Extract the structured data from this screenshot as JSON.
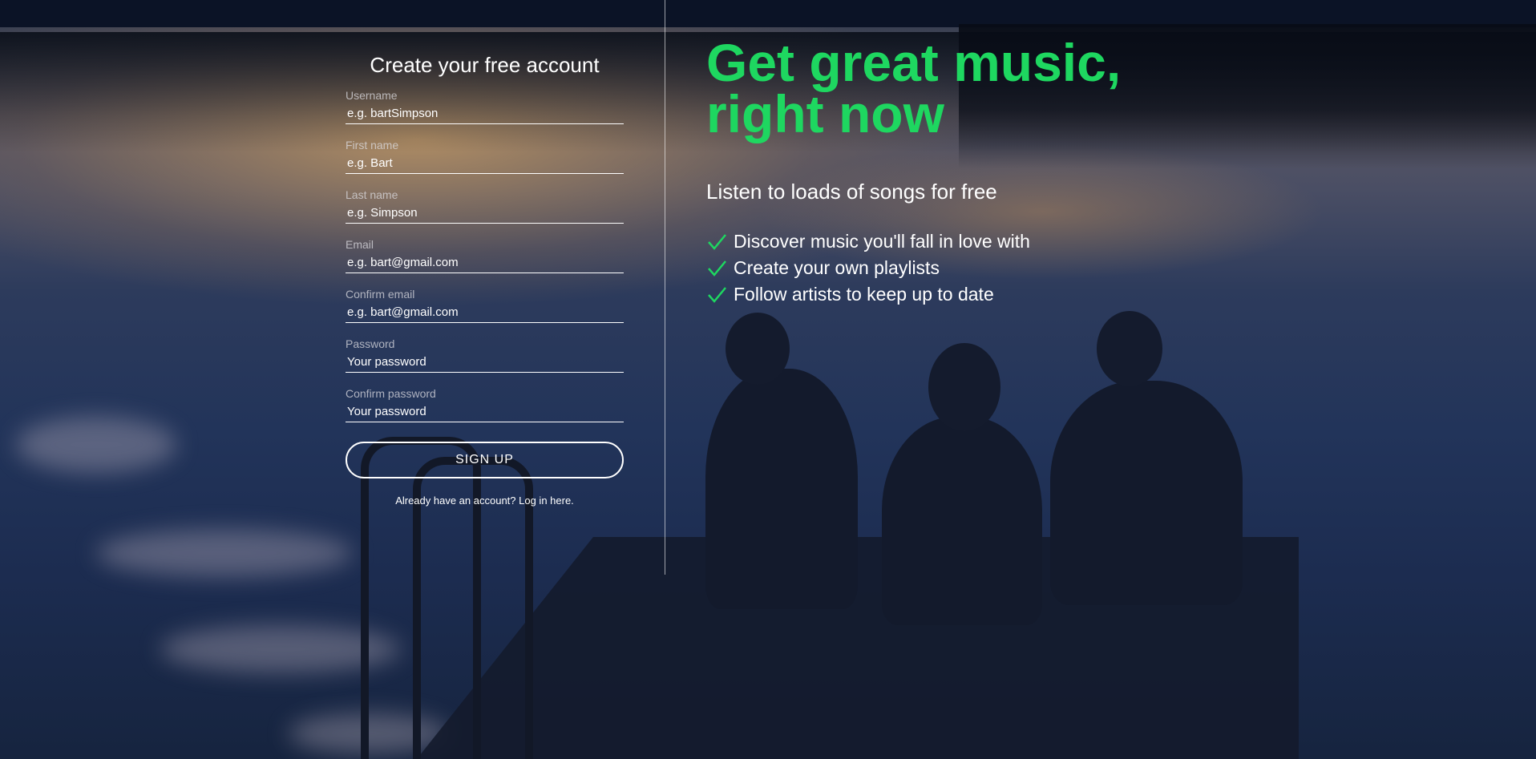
{
  "colors": {
    "accent": "#1ed760"
  },
  "signup": {
    "title": "Create your free account",
    "fields": [
      {
        "label": "Username",
        "placeholder": "e.g. bartSimpson"
      },
      {
        "label": "First name",
        "placeholder": "e.g. Bart"
      },
      {
        "label": "Last name",
        "placeholder": "e.g. Simpson"
      },
      {
        "label": "Email",
        "placeholder": "e.g. bart@gmail.com"
      },
      {
        "label": "Confirm email",
        "placeholder": "e.g. bart@gmail.com"
      },
      {
        "label": "Password",
        "placeholder": "Your password"
      },
      {
        "label": "Confirm password",
        "placeholder": "Your password"
      }
    ],
    "button_label": "SIGN UP",
    "login_text": "Already have an account? Log in here."
  },
  "promo": {
    "headline_line1": "Get great music,",
    "headline_line2": "right now",
    "subhead": "Listen to loads of songs for free",
    "features": [
      {
        "icon": "check-icon",
        "text": "Discover music you'll fall in love with"
      },
      {
        "icon": "check-icon",
        "text": "Create your own playlists"
      },
      {
        "icon": "check-icon",
        "text": "Follow artists to keep up to date"
      }
    ]
  }
}
